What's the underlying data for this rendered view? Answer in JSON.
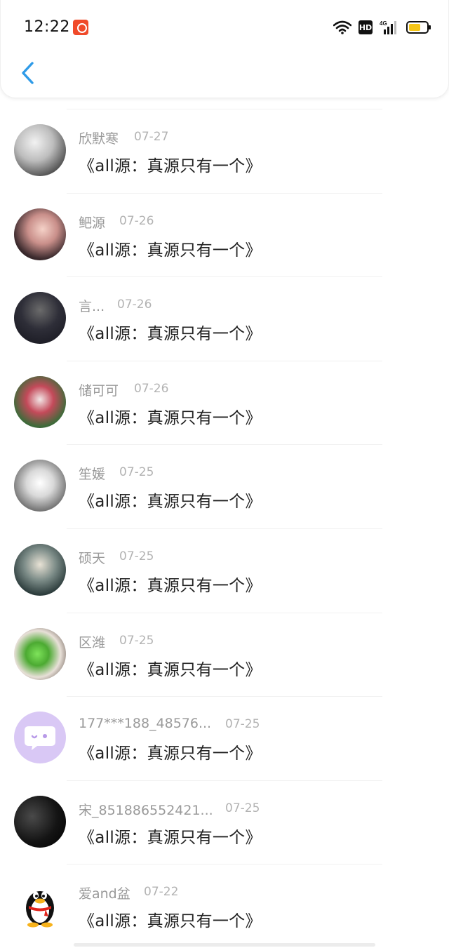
{
  "status_bar": {
    "time": "12:22",
    "hd_label": "HD",
    "network_label": "4G",
    "battery_color": "#f5c518"
  },
  "header": {
    "back_icon": "chevron-left-icon",
    "accent_color": "#2f9be8"
  },
  "messages": [
    {
      "name": "欣默寒",
      "date": "07-27",
      "text": "《all源：真源只有一个》"
    },
    {
      "name": "鲃源",
      "date": "07-26",
      "text": "《all源：真源只有一个》"
    },
    {
      "name": "言...",
      "date": "07-26",
      "text": "《all源：真源只有一个》"
    },
    {
      "name": "储可可",
      "date": "07-26",
      "text": "《all源：真源只有一个》"
    },
    {
      "name": "笙媛",
      "date": "07-25",
      "text": "《all源：真源只有一个》"
    },
    {
      "name": "硕天",
      "date": "07-25",
      "text": "《all源：真源只有一个》"
    },
    {
      "name": "区潍",
      "date": "07-25",
      "text": "《all源：真源只有一个》"
    },
    {
      "name": "177***188_48576...",
      "date": "07-25",
      "text": "《all源：真源只有一个》"
    },
    {
      "name": "宋_851886552421...",
      "date": "07-25",
      "text": "《all源：真源只有一个》"
    },
    {
      "name": "爱and盆",
      "date": "07-22",
      "text": "《all源：真源只有一个》"
    }
  ]
}
